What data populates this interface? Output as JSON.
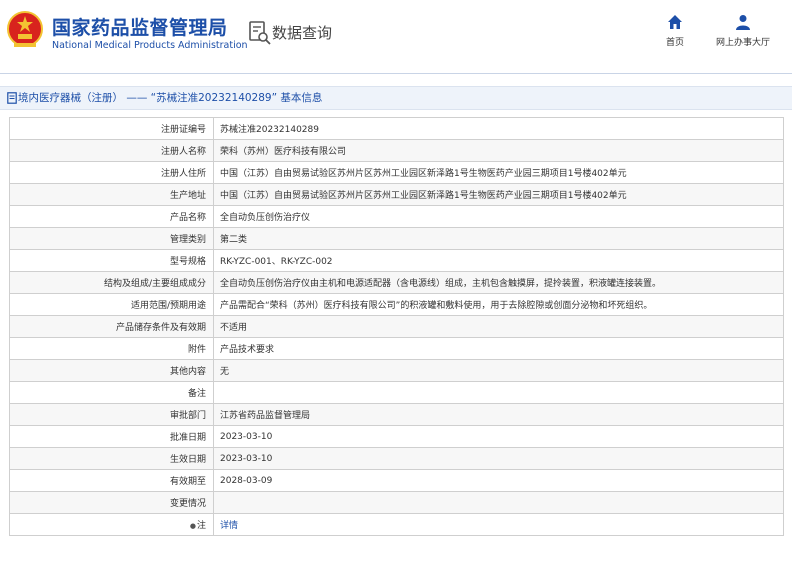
{
  "header": {
    "brand_cn": "国家药品监督管理局",
    "brand_en": "National Medical Products Administration",
    "query_label": "数据查询",
    "nav": [
      {
        "label": "首页",
        "icon": "home-icon"
      },
      {
        "label": "网上办事大厅",
        "icon": "user-icon"
      }
    ]
  },
  "breadcrumb": "境内医疗器械（注册） —— “苏械注准20232140289” 基本信息",
  "colors": {
    "brand_blue": "#1d4fa8",
    "emblem_red": "#d8231d",
    "emblem_gold": "#f3c332"
  },
  "rows": [
    {
      "label": "注册证编号",
      "value": "苏械注准20232140289"
    },
    {
      "label": "注册人名称",
      "value": "荣科（苏州）医疗科技有限公司"
    },
    {
      "label": "注册人住所",
      "value": "中国（江苏）自由贸易试验区苏州片区苏州工业园区新泽路1号生物医药产业园三期项目1号楼402单元"
    },
    {
      "label": "生产地址",
      "value": "中国（江苏）自由贸易试验区苏州片区苏州工业园区新泽路1号生物医药产业园三期项目1号楼402单元"
    },
    {
      "label": "产品名称",
      "value": "全自动负压创伤治疗仪"
    },
    {
      "label": "管理类别",
      "value": "第二类"
    },
    {
      "label": "型号规格",
      "value": "RK-YZC-001、RK-YZC-002"
    },
    {
      "label": "结构及组成/主要组成成分",
      "value": "全自动负压创伤治疗仪由主机和电源适配器（含电源线）组成，主机包含触摸屏，提拎装置，积液罐连接装置。"
    },
    {
      "label": "适用范围/预期用途",
      "value": "产品需配合“荣科（苏州）医疗科技有限公司”的积液罐和敷料使用，用于去除腔隙或创面分泌物和坏死组织。"
    },
    {
      "label": "产品储存条件及有效期",
      "value": "不适用"
    },
    {
      "label": "附件",
      "value": "产品技术要求"
    },
    {
      "label": "其他内容",
      "value": "无"
    },
    {
      "label": "备注",
      "value": ""
    },
    {
      "label": "审批部门",
      "value": "江苏省药品监督管理局"
    },
    {
      "label": "批准日期",
      "value": "2023-03-10"
    },
    {
      "label": "生效日期",
      "value": "2023-03-10"
    },
    {
      "label": "有效期至",
      "value": "2028-03-09"
    },
    {
      "label": "变更情况",
      "value": ""
    },
    {
      "label": "注",
      "value": "详情",
      "label_icon": "pin-icon"
    }
  ]
}
